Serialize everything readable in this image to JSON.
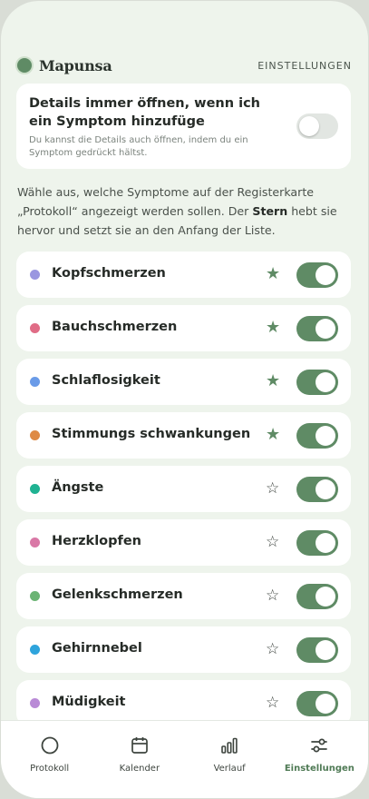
{
  "header": {
    "app_name": "Mapunsa",
    "settings_link": "EINSTELLUNGEN"
  },
  "details_card": {
    "title": "Details immer öffnen, wenn ich ein Symptom hinzufüge",
    "subtitle": "Du kannst die Details auch öffnen, indem du ein Symptom gedrückt hältst.",
    "toggle_on": false
  },
  "intro": {
    "part1": "Wähle aus, welche Symptome auf der Registerkarte „Protokoll“ angezeigt werden sollen. Der ",
    "bold": "Stern",
    "part2": " hebt sie hervor und setzt sie an den Anfang der Liste."
  },
  "symptoms": [
    {
      "label": "Kopfschmerzen",
      "color": "#9a97e0",
      "starred": true,
      "enabled": true
    },
    {
      "label": "Bauchschmerzen",
      "color": "#e06c86",
      "starred": true,
      "enabled": true
    },
    {
      "label": "Schlaflosigkeit",
      "color": "#6a9be8",
      "starred": true,
      "enabled": true
    },
    {
      "label": "Stimmungs schwankungen",
      "color": "#de8a45",
      "starred": true,
      "enabled": true
    },
    {
      "label": "Ängste",
      "color": "#1fb292",
      "starred": false,
      "enabled": true
    },
    {
      "label": "Herzklopfen",
      "color": "#d978a6",
      "starred": false,
      "enabled": true
    },
    {
      "label": "Gelenkschmerzen",
      "color": "#6bb474",
      "starred": false,
      "enabled": true
    },
    {
      "label": "Gehirnnebel",
      "color": "#2ea4dc",
      "starred": false,
      "enabled": true
    },
    {
      "label": "Müdigkeit",
      "color": "#b98ad6",
      "starred": false,
      "enabled": true
    }
  ],
  "nav": {
    "items": [
      {
        "label": "Protokoll",
        "icon": "circle-icon",
        "active": false
      },
      {
        "label": "Kalender",
        "icon": "calendar-icon",
        "active": false
      },
      {
        "label": "Verlauf",
        "icon": "bar-chart-icon",
        "active": false
      },
      {
        "label": "Einstellungen",
        "icon": "sliders-icon",
        "active": true
      }
    ]
  },
  "colors": {
    "accent": "#5f8b65",
    "background": "#eef4ec",
    "star_empty": "#3a403b"
  }
}
